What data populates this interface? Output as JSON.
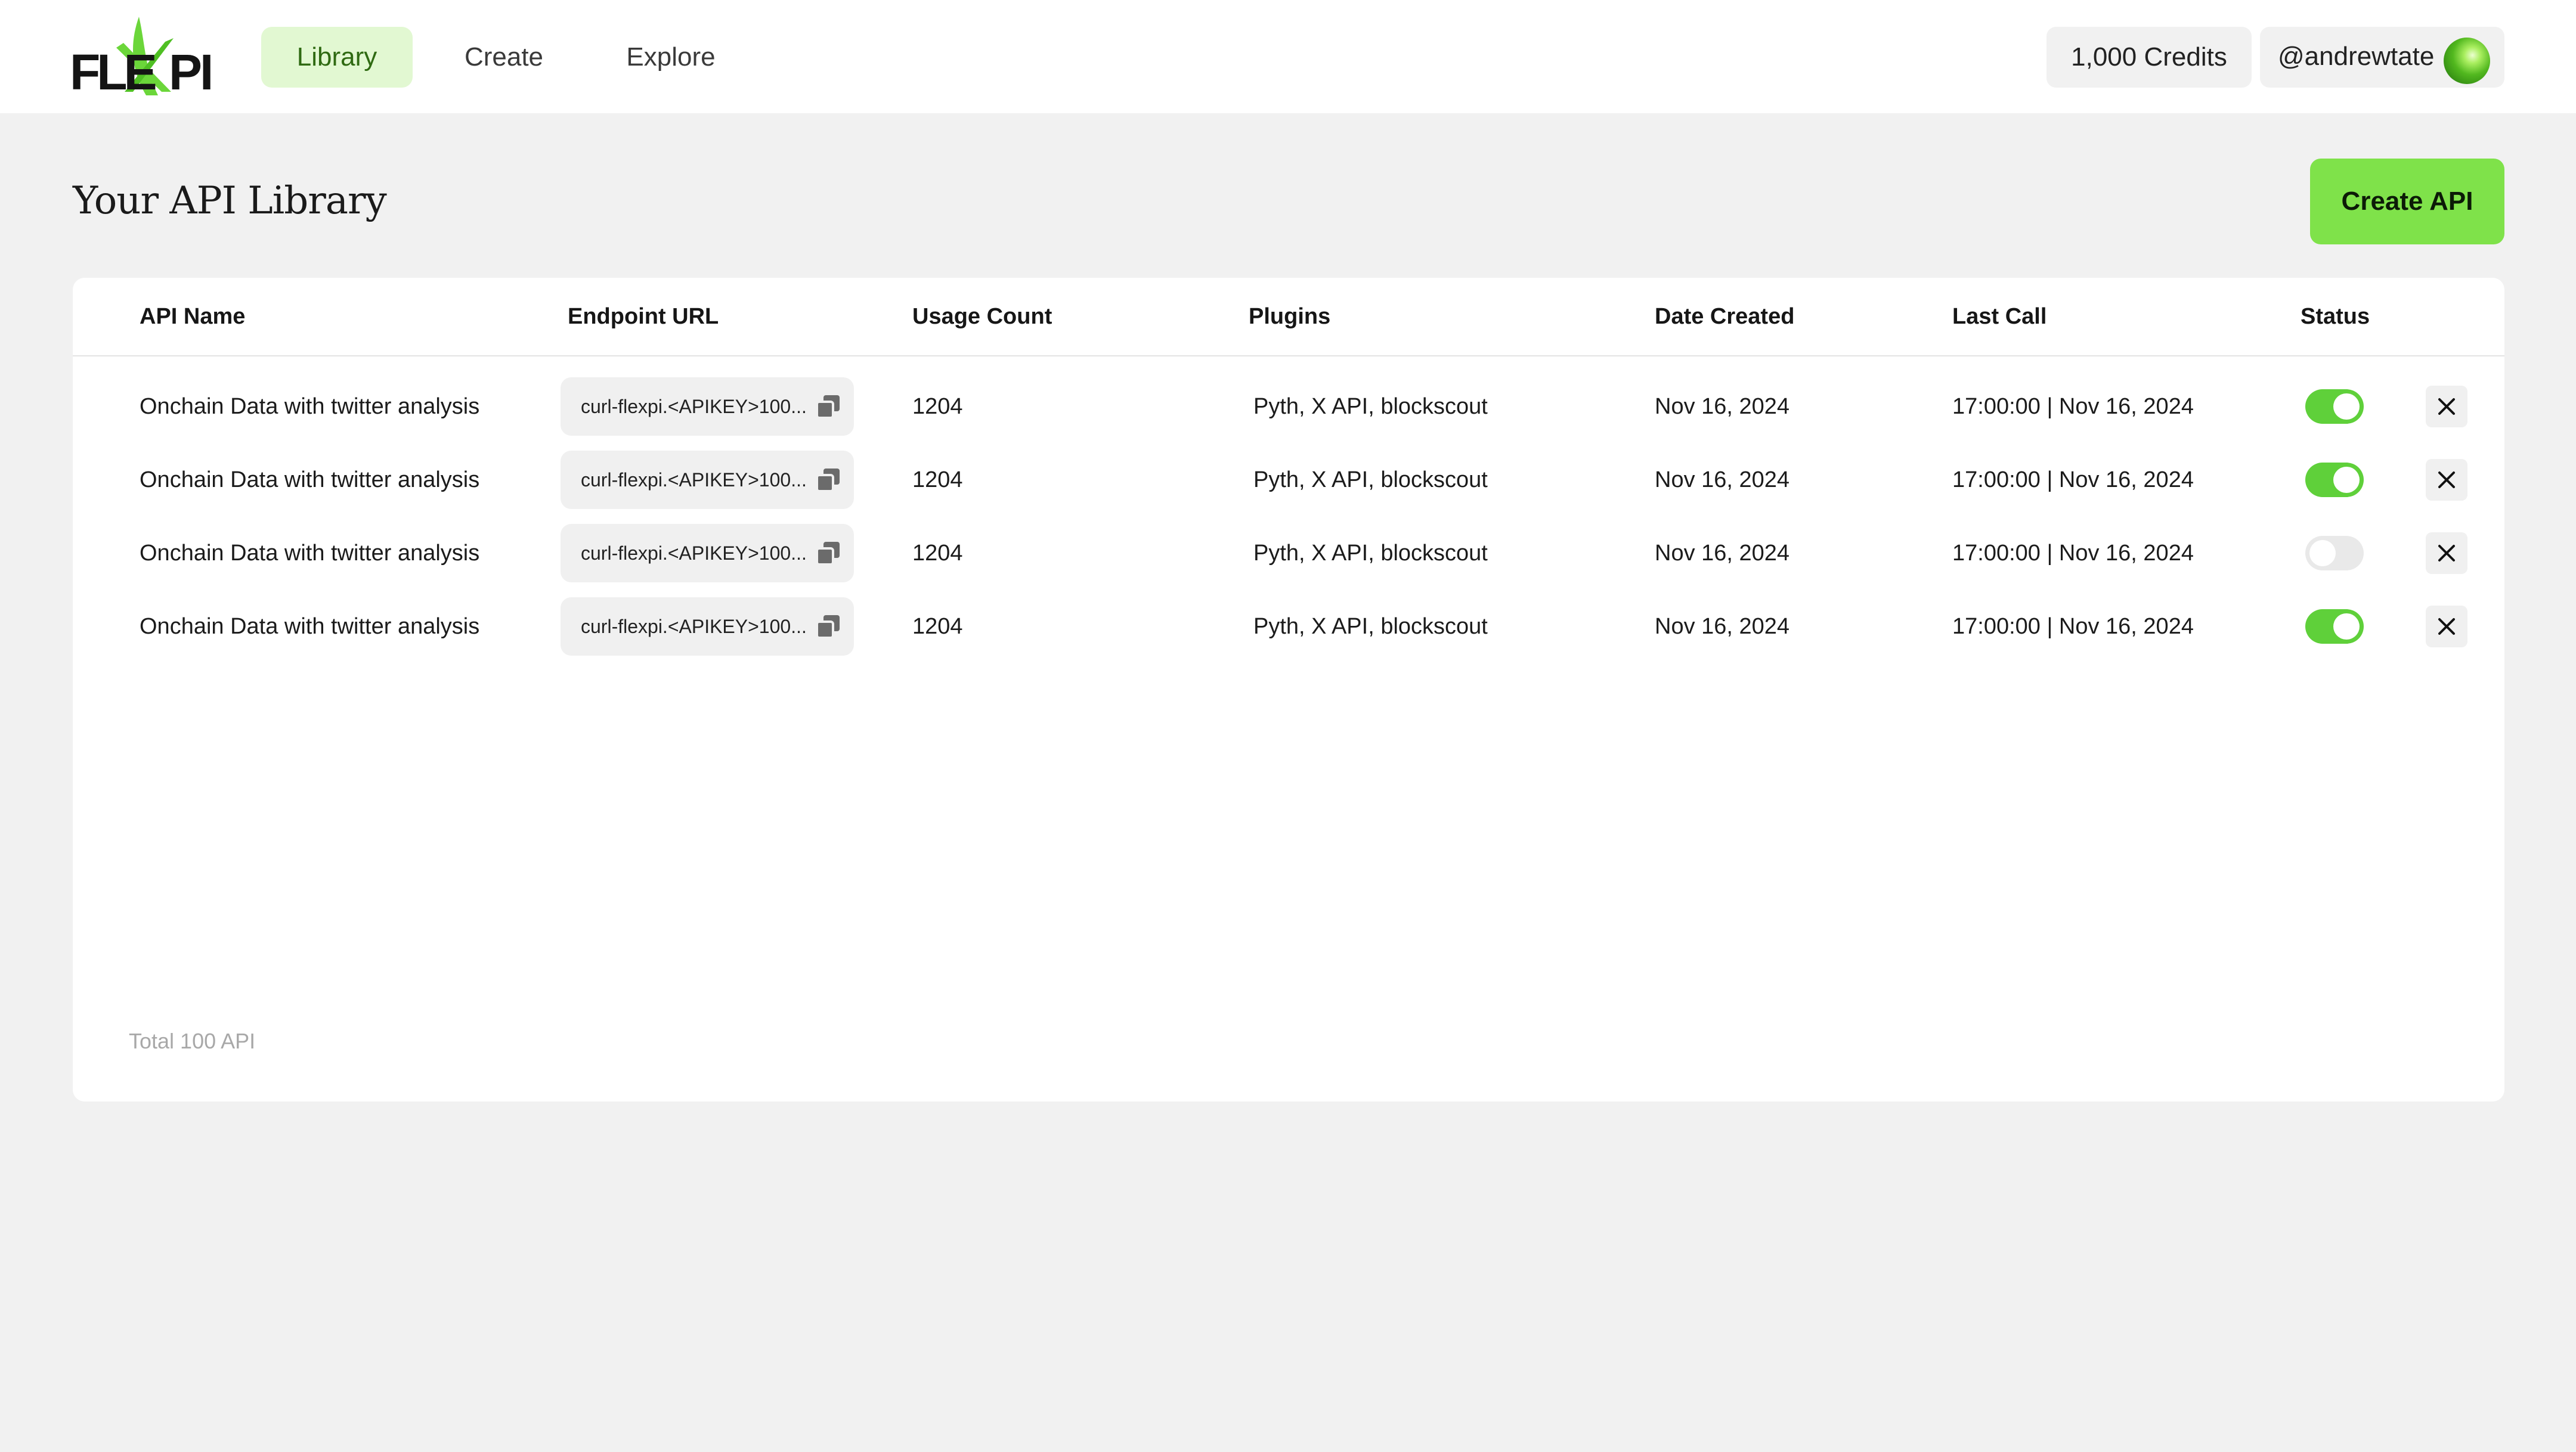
{
  "brand": {
    "logo_text": "FLEXPI"
  },
  "nav": {
    "tabs": [
      {
        "label": "Library",
        "active": true
      },
      {
        "label": "Create",
        "active": false
      },
      {
        "label": "Explore",
        "active": false
      }
    ]
  },
  "account": {
    "credits": "1,000 Credits",
    "username": "@andrewtate"
  },
  "page": {
    "title": "Your API Library",
    "create_button": "Create API"
  },
  "table": {
    "columns": [
      "API Name",
      "Endpoint URL",
      "Usage Count",
      "Plugins",
      "Date Created",
      "Last Call",
      "Status"
    ],
    "rows": [
      {
        "name": "Onchain Data with twitter analysis",
        "endpoint": "curl-flexpi.<APIKEY>100...",
        "usage": "1204",
        "plugins": "Pyth, X API, blockscout",
        "created": "Nov 16, 2024",
        "last_call": "17:00:00 | Nov 16, 2024",
        "enabled": true
      },
      {
        "name": "Onchain Data with twitter analysis",
        "endpoint": "curl-flexpi.<APIKEY>100...",
        "usage": "1204",
        "plugins": "Pyth, X API, blockscout",
        "created": "Nov 16, 2024",
        "last_call": "17:00:00 | Nov 16, 2024",
        "enabled": true
      },
      {
        "name": "Onchain Data with twitter analysis",
        "endpoint": "curl-flexpi.<APIKEY>100...",
        "usage": "1204",
        "plugins": "Pyth, X API, blockscout",
        "created": "Nov 16, 2024",
        "last_call": "17:00:00 | Nov 16, 2024",
        "enabled": false
      },
      {
        "name": "Onchain Data with twitter analysis",
        "endpoint": "curl-flexpi.<APIKEY>100...",
        "usage": "1204",
        "plugins": "Pyth, X API, blockscout",
        "created": "Nov 16, 2024",
        "last_call": "17:00:00 | Nov 16, 2024",
        "enabled": true
      }
    ],
    "total": "Total 100 API"
  },
  "icons": {
    "copy": "copy-icon",
    "delete": "close-icon"
  },
  "colors": {
    "accent": "#7fe24a",
    "toggle_on": "#5fd03a",
    "nav_active_bg": "#e2f8d2"
  }
}
